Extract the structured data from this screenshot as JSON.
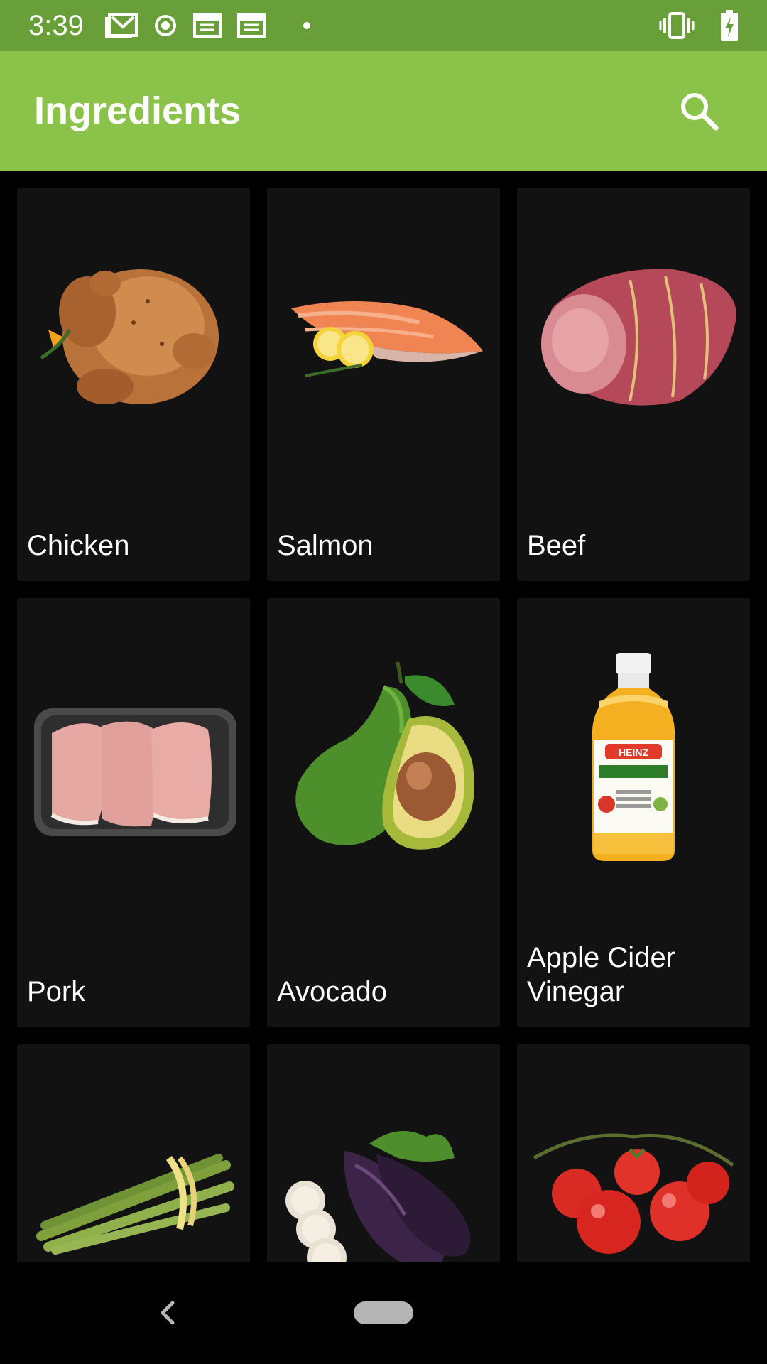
{
  "status_bar": {
    "time": "3:39",
    "left_icons": [
      "mail-icon",
      "record-icon",
      "calendar-icon",
      "calendar-icon",
      "dot-icon"
    ],
    "right_icons": [
      "vibrate-icon",
      "battery-charging-icon"
    ],
    "color": "#689f38"
  },
  "app_bar": {
    "title": "Ingredients",
    "search_icon": "search-icon",
    "color": "#8bc34a"
  },
  "ingredients": [
    {
      "label": "Chicken",
      "icon": "chicken-image"
    },
    {
      "label": "Salmon",
      "icon": "salmon-image"
    },
    {
      "label": "Beef",
      "icon": "beef-image"
    },
    {
      "label": "Pork",
      "icon": "pork-image"
    },
    {
      "label": "Avocado",
      "icon": "avocado-image"
    },
    {
      "label": "Apple Cider Vinegar",
      "icon": "vinegar-bottle-image"
    },
    {
      "label": "",
      "icon": "asparagus-image"
    },
    {
      "label": "",
      "icon": "eggplant-image"
    },
    {
      "label": "",
      "icon": "tomato-image"
    }
  ],
  "nav_bar": {
    "back_icon": "back-chevron-icon",
    "home_icon": "home-pill-icon"
  }
}
